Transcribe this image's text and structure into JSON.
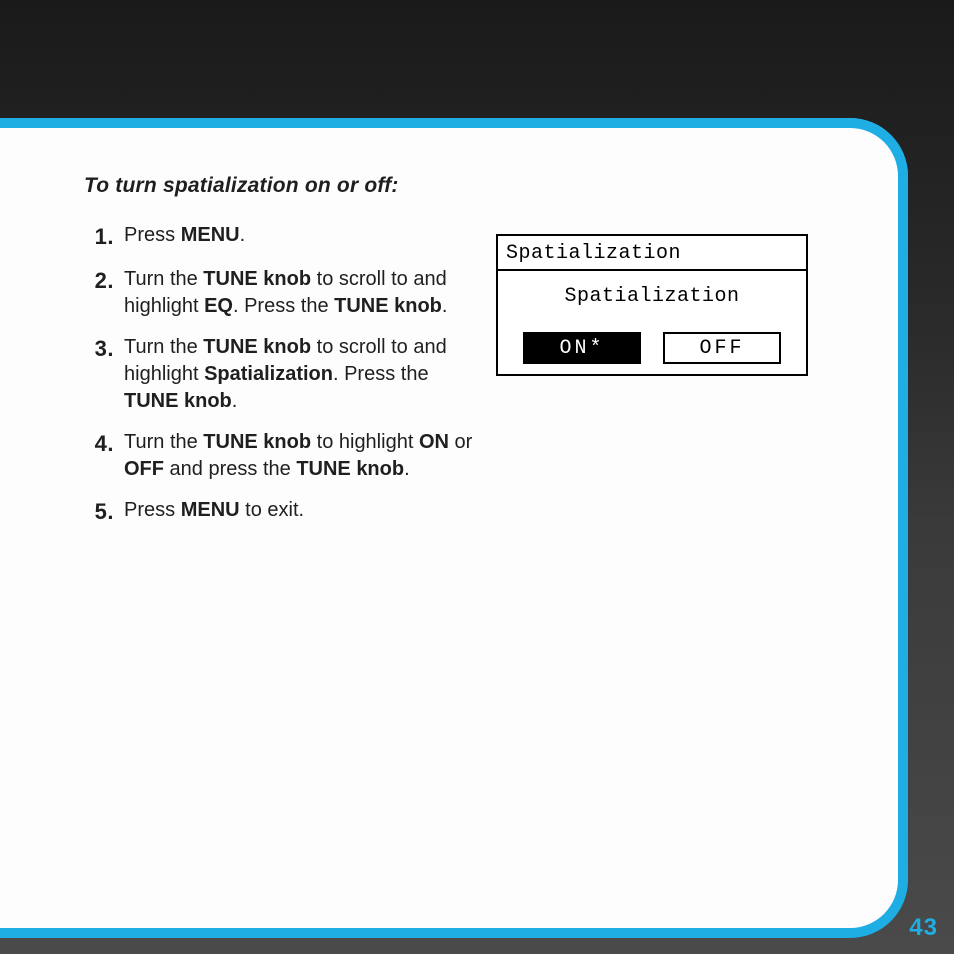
{
  "heading": "To turn spatialization on or off:",
  "steps": [
    {
      "num": "1.",
      "parts": [
        "Press ",
        [
          "b",
          "MENU"
        ],
        "."
      ]
    },
    {
      "num": "2.",
      "parts": [
        "Turn the ",
        [
          "b",
          "TUNE knob"
        ],
        " to scroll to and highlight ",
        [
          "b",
          "EQ"
        ],
        ". Press the ",
        [
          "b",
          "TUNE knob"
        ],
        "."
      ]
    },
    {
      "num": "3.",
      "parts": [
        "Turn the ",
        [
          "b",
          "TUNE knob"
        ],
        " to scroll to and highlight ",
        [
          "b",
          "Spatialization"
        ],
        ". Press the ",
        [
          "b",
          "TUNE knob"
        ],
        "."
      ]
    },
    {
      "num": "4.",
      "parts": [
        "Turn the ",
        [
          "b",
          "TUNE knob"
        ],
        " to highlight ",
        [
          "b",
          "ON"
        ],
        " or ",
        [
          "b",
          "OFF"
        ],
        " and press the ",
        [
          "b",
          "TUNE knob"
        ],
        "."
      ]
    },
    {
      "num": "5.",
      "parts": [
        "Press ",
        [
          "b",
          "MENU"
        ],
        " to exit."
      ]
    }
  ],
  "lcd": {
    "title": "Spatialization",
    "subtitle": "Spatialization",
    "on_label": "ON*",
    "off_label": "OFF"
  },
  "page_number": "43"
}
